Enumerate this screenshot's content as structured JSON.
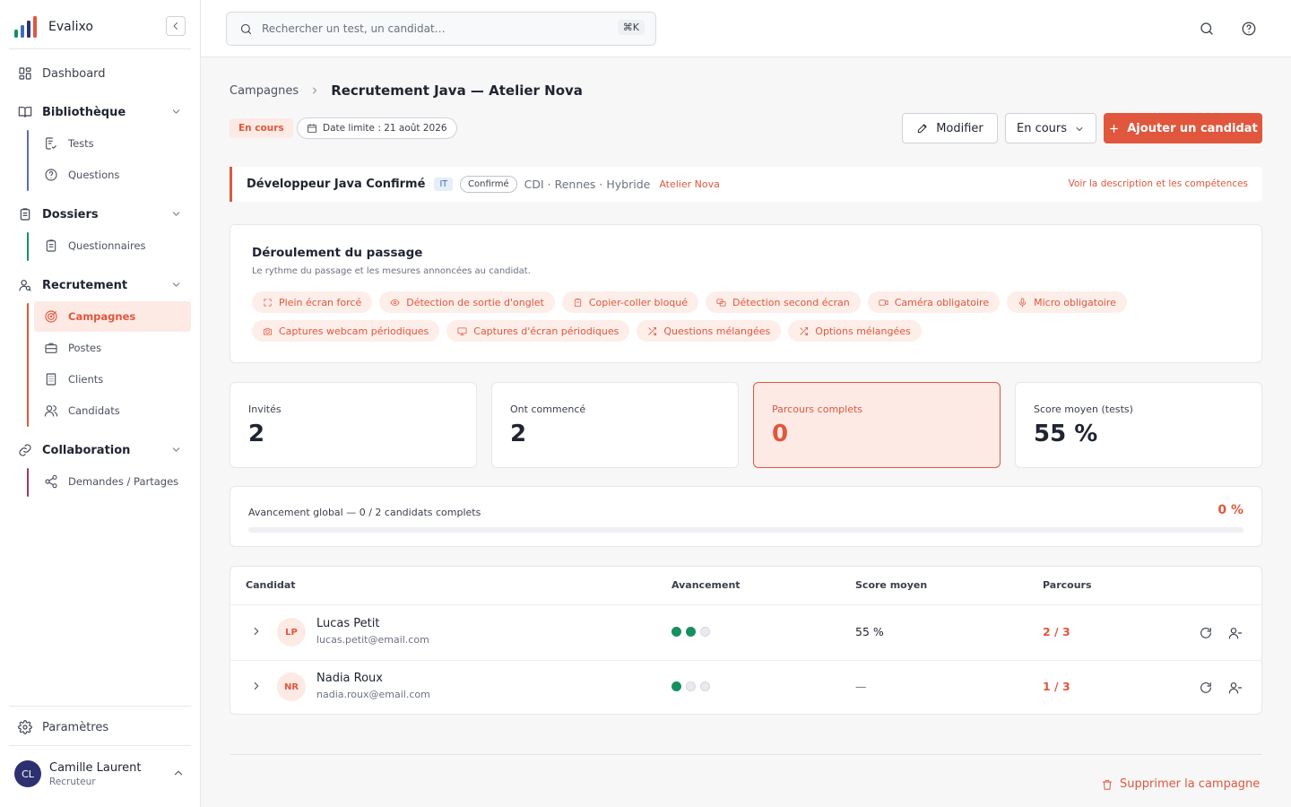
{
  "app": {
    "name": "Evalixo"
  },
  "search": {
    "placeholder": "Rechercher un test, un candidat…",
    "shortcut": "⌘K"
  },
  "sidebar": {
    "dashboard": "Dashboard",
    "bibliotheque": {
      "label": "Bibliothèque",
      "items": [
        "Tests",
        "Questions"
      ]
    },
    "dossiers": {
      "label": "Dossiers",
      "items": [
        "Questionnaires"
      ]
    },
    "recrutement": {
      "label": "Recrutement",
      "items": [
        "Campagnes",
        "Postes",
        "Clients",
        "Candidats"
      ]
    },
    "collaboration": {
      "label": "Collaboration",
      "items": [
        "Demandes / Partages"
      ]
    },
    "settings": "Paramètres",
    "user": {
      "initials": "CL",
      "name": "Camille Laurent",
      "role": "Recruteur"
    }
  },
  "breadcrumb": {
    "parent": "Campagnes",
    "current": "Recrutement Java — Atelier Nova"
  },
  "campaign": {
    "status_badge": "En cours",
    "deadline": "Date limite : 21 août 2026",
    "edit_label": "Modifier",
    "status_select": "En cours",
    "add_candidate_label": "Ajouter un candidat"
  },
  "job": {
    "title": "Développeur Java Confirmé",
    "category": "IT",
    "level": "Confirmé",
    "meta": "CDI · Rennes · Hybride",
    "client": "Atelier Nova",
    "link": "Voir la description et les compétences"
  },
  "flow": {
    "title": "Déroulement du passage",
    "subtitle": "Le rythme du passage et les mesures annoncées au candidat.",
    "chips": [
      {
        "label": "Plein écran forcé",
        "icon": "fullscreen-icon"
      },
      {
        "label": "Détection de sortie d'onglet",
        "icon": "eye-icon"
      },
      {
        "label": "Copier-coller bloqué",
        "icon": "clipboard-icon"
      },
      {
        "label": "Détection second écran",
        "icon": "screens-icon"
      },
      {
        "label": "Caméra obligatoire",
        "icon": "video-icon"
      },
      {
        "label": "Micro obligatoire",
        "icon": "mic-icon"
      },
      {
        "label": "Captures webcam périodiques",
        "icon": "camera-icon"
      },
      {
        "label": "Captures d'écran périodiques",
        "icon": "monitor-icon"
      },
      {
        "label": "Questions mélangées",
        "icon": "shuffle-icon"
      },
      {
        "label": "Options mélangées",
        "icon": "shuffle-icon"
      }
    ]
  },
  "stats": [
    {
      "label": "Invités",
      "value": "2"
    },
    {
      "label": "Ont commencé",
      "value": "2"
    },
    {
      "label": "Parcours complets",
      "value": "0"
    },
    {
      "label": "Score moyen (tests)",
      "value": "55 %"
    }
  ],
  "progress": {
    "label": "Avancement global — 0 / 2 candidats complets",
    "percent_text": "0 %",
    "fraction": 0
  },
  "table": {
    "headers": [
      "Candidat",
      "Avancement",
      "Score moyen",
      "Parcours"
    ],
    "rows": [
      {
        "initials": "LP",
        "name": "Lucas Petit",
        "email": "lucas.petit@email.com",
        "progress": [
          true,
          true,
          false
        ],
        "score": "55 %",
        "parcours": "2 / 3"
      },
      {
        "initials": "NR",
        "name": "Nadia Roux",
        "email": "nadia.roux@email.com",
        "progress": [
          true,
          false,
          false
        ],
        "score": "—",
        "parcours": "1 / 3"
      }
    ]
  },
  "delete_label": "Supprimer la campagne",
  "colors": {
    "accent": "#e0573d",
    "accent_soft": "#fdeae5",
    "success": "#169060",
    "sidebar_avatar": "#2e3170"
  }
}
